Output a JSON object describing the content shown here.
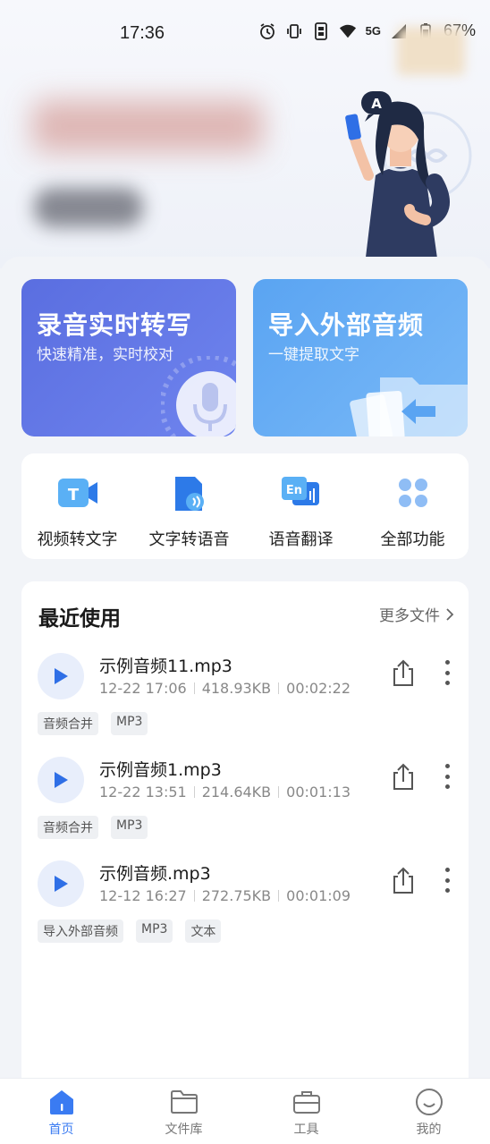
{
  "status_bar": {
    "time": "17:36",
    "network": "5G",
    "battery": "67%"
  },
  "feature_cards": [
    {
      "title": "录音实时转写",
      "subtitle": "快速精准，实时校对"
    },
    {
      "title": "导入外部音频",
      "subtitle": "一键提取文字"
    }
  ],
  "quick_tools": [
    {
      "label": "视频转文字",
      "icon": "video-to-text-icon"
    },
    {
      "label": "文字转语音",
      "icon": "text-to-speech-icon"
    },
    {
      "label": "语音翻译",
      "icon": "voice-translate-icon"
    },
    {
      "label": "全部功能",
      "icon": "all-features-icon"
    }
  ],
  "recent": {
    "title": "最近使用",
    "more_label": "更多文件",
    "files": [
      {
        "name": "示例音频11.mp3",
        "date": "12-22 17:06",
        "size": "418.93KB",
        "duration": "00:02:22",
        "tags": [
          "音频合并",
          "MP3"
        ]
      },
      {
        "name": "示例音频1.mp3",
        "date": "12-22 13:51",
        "size": "214.64KB",
        "duration": "00:01:13",
        "tags": [
          "音频合并",
          "MP3"
        ]
      },
      {
        "name": "示例音频.mp3",
        "date": "12-12 16:27",
        "size": "272.75KB",
        "duration": "00:01:09",
        "tags": [
          "导入外部音频",
          "MP3",
          "文本"
        ]
      }
    ]
  },
  "tabbar": {
    "items": [
      {
        "label": "首页",
        "active": true
      },
      {
        "label": "文件库",
        "active": false
      },
      {
        "label": "工具",
        "active": false
      },
      {
        "label": "我的",
        "active": false
      }
    ]
  },
  "colors": {
    "accent": "#3a7bf2",
    "record_card": "#5a6ee0",
    "import_card": "#5aa4f2"
  }
}
